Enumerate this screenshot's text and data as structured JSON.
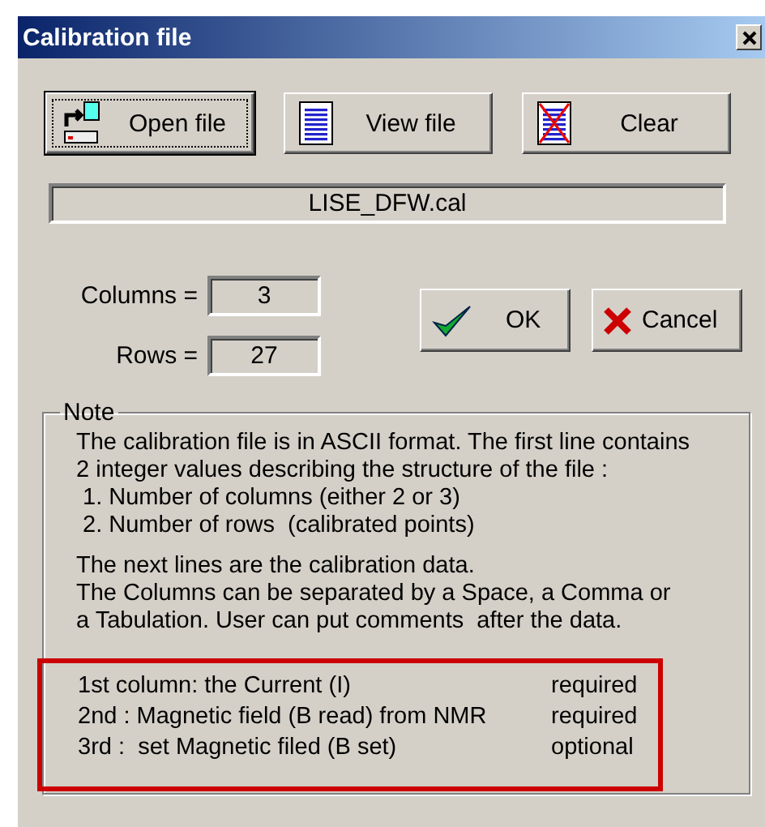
{
  "window": {
    "title": "Calibration file"
  },
  "toolbar": [
    {
      "kind": "open",
      "label": "Open file",
      "focused": true
    },
    {
      "kind": "view",
      "label": "View file",
      "focused": false
    },
    {
      "kind": "clear",
      "label": "Clear",
      "focused": false
    }
  ],
  "file_name": "LISE_DFW.cal",
  "fields": [
    {
      "label": "Columns =",
      "value": "3"
    },
    {
      "label": "Rows =",
      "value": "27"
    }
  ],
  "actions": [
    {
      "kind": "ok",
      "label": "OK"
    },
    {
      "kind": "cancel",
      "label": "Cancel"
    }
  ],
  "note": {
    "title": "Note",
    "paragraphs": [
      [
        "The calibration file is in ASCII format. The first line contains",
        "2 integer values describing the structure of the file :",
        " 1. Number of columns (either 2 or 3)",
        " 2. Number of rows  (calibrated points)"
      ],
      [
        "The next lines are the calibration data.",
        "The Columns can be separated by a Space, a Comma or",
        "a Tabulation. User can put comments  after the data."
      ]
    ],
    "columns": [
      {
        "label": "1st column: the Current (I)",
        "status": "required"
      },
      {
        "label": "2nd : Magnetic field (B read) from NMR",
        "status": "required"
      },
      {
        "label": "3rd :  set Magnetic filed (B set)",
        "status": "optional"
      }
    ]
  }
}
